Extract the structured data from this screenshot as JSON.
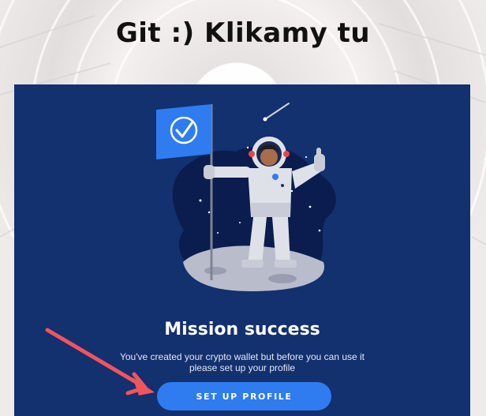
{
  "overlay": {
    "heading": "Git :) Klikamy tu"
  },
  "card": {
    "title": "Mission success",
    "description_line1": "You've created your crypto wallet but before you can use it",
    "description_line2": "please set up your profile",
    "button_label": "SET UP PROFILE"
  },
  "colors": {
    "card_background": "#13306f",
    "button": "#2e7cf0",
    "arrow": "#f2545b",
    "flag": "#2e7cf0"
  },
  "icons": {
    "flag": "checkmark-flag-icon",
    "illustration": "astronaut-illustration",
    "pointer": "red-arrow"
  }
}
